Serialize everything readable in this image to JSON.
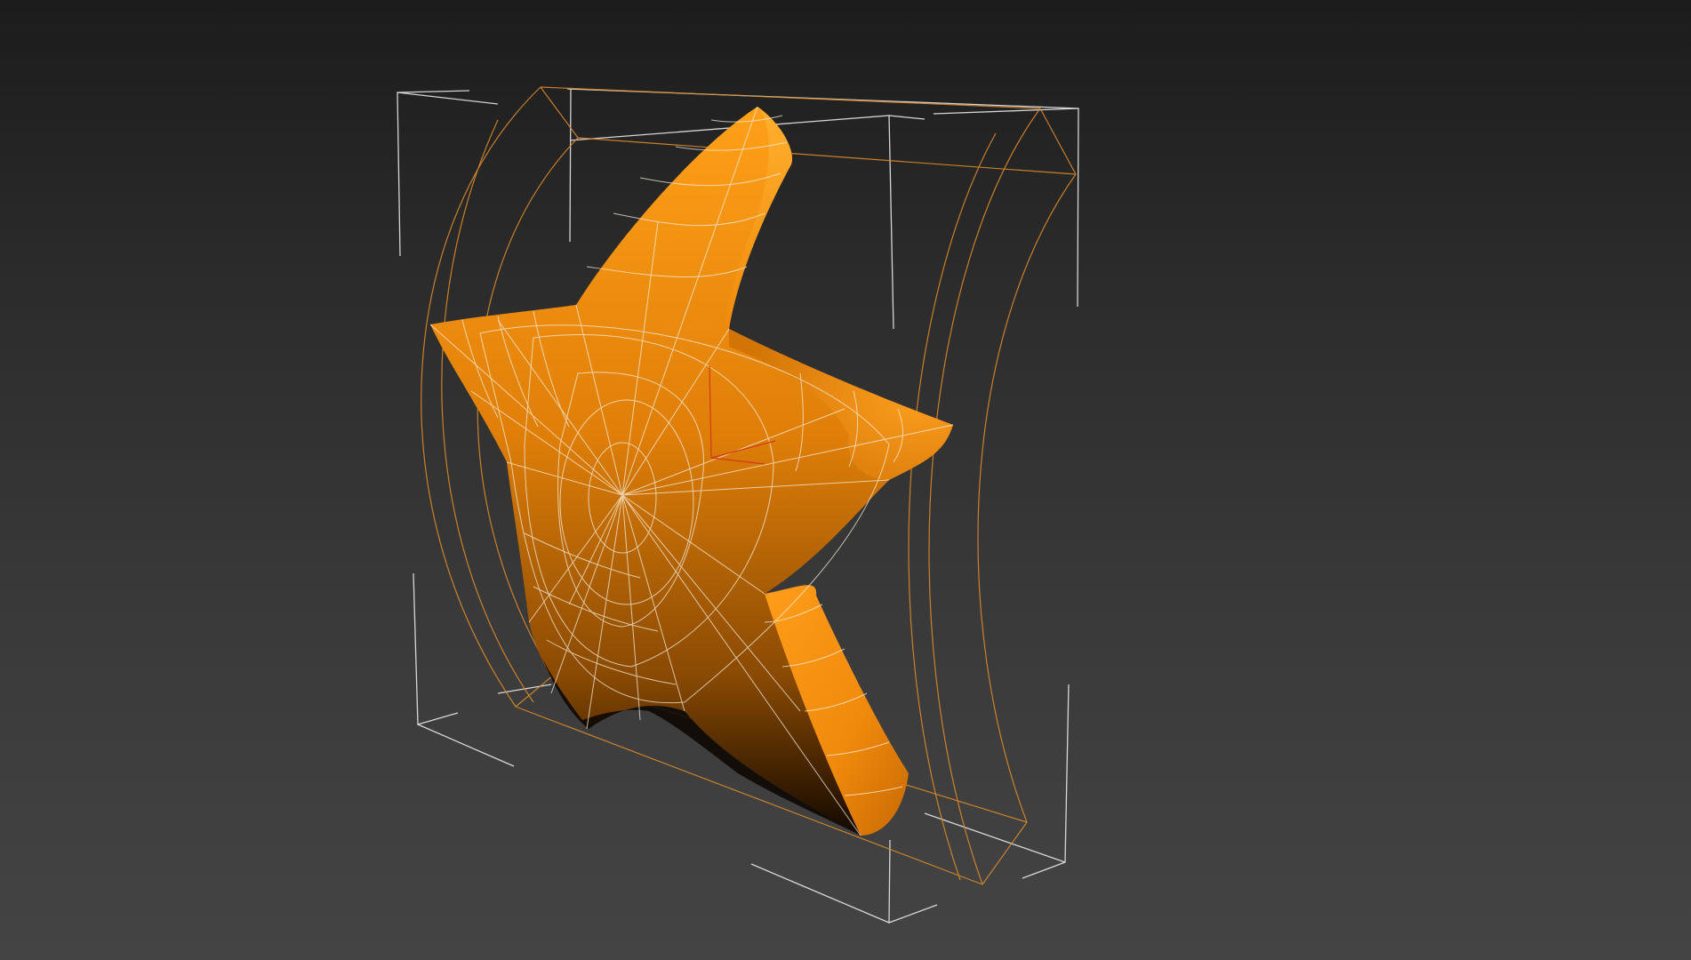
{
  "viewport": {
    "background_top": "#1c1c1c",
    "background_bottom": "#444444"
  },
  "object": {
    "shape": "star",
    "color": "#e07f08",
    "highlight_color": "#ffa019",
    "shadow_color": "#000000",
    "wireframe_color": "#f5ecd9",
    "selected": true
  },
  "bounding_box": {
    "color": "#e8e8e8"
  },
  "bend_gizmo": {
    "color": "#d98a2a"
  },
  "pivot_axes": {
    "color": "#d23a1a"
  }
}
